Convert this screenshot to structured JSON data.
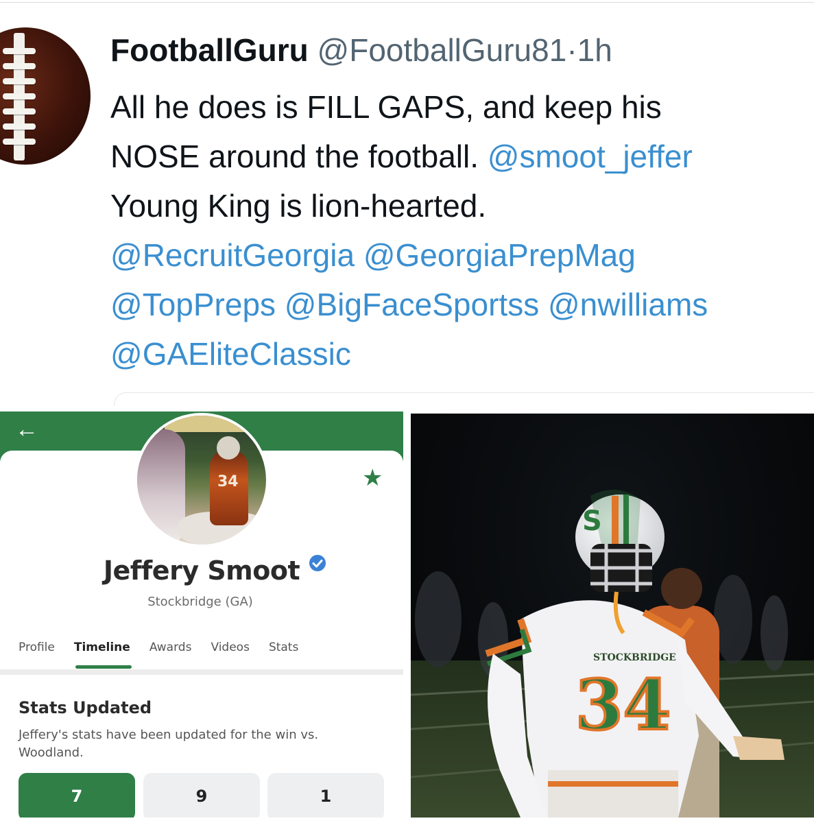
{
  "tweet": {
    "display_name": "FootballGuru",
    "handle": "@FootballGuru81",
    "separator": "·",
    "time": "1h",
    "line1": "All he does is FILL GAPS, and keep his",
    "line2_text": "NOSE around the football.",
    "line2_mention": "@smoot_jeffer",
    "line3": "Young King is lion-hearted.",
    "mentions_line4": "@RecruitGeorgia @GeorgiaPrepMag",
    "mentions_line5": "@TopPreps @BigFaceSportss @nwilliams",
    "mentions_line6": "@GAEliteClassic",
    "mention_color": "#3a8fd0"
  },
  "profile": {
    "accent_color": "#2f7f47",
    "name": "Jeffery Smoot",
    "location": "Stockbridge (GA)",
    "tabs": [
      {
        "label": "Profile",
        "active": false
      },
      {
        "label": "Timeline",
        "active": true
      },
      {
        "label": "Awards",
        "active": false
      },
      {
        "label": "Videos",
        "active": false
      },
      {
        "label": "Stats",
        "active": false
      }
    ],
    "post": {
      "title": "Stats Updated",
      "text": "Jeffery's stats have been updated for the win vs. Woodland."
    },
    "stat_values": [
      "7",
      "9",
      "1"
    ],
    "jersey_number": "34"
  },
  "photo": {
    "jersey_text": "STOCKBRIDGE",
    "jersey_number": "34"
  }
}
